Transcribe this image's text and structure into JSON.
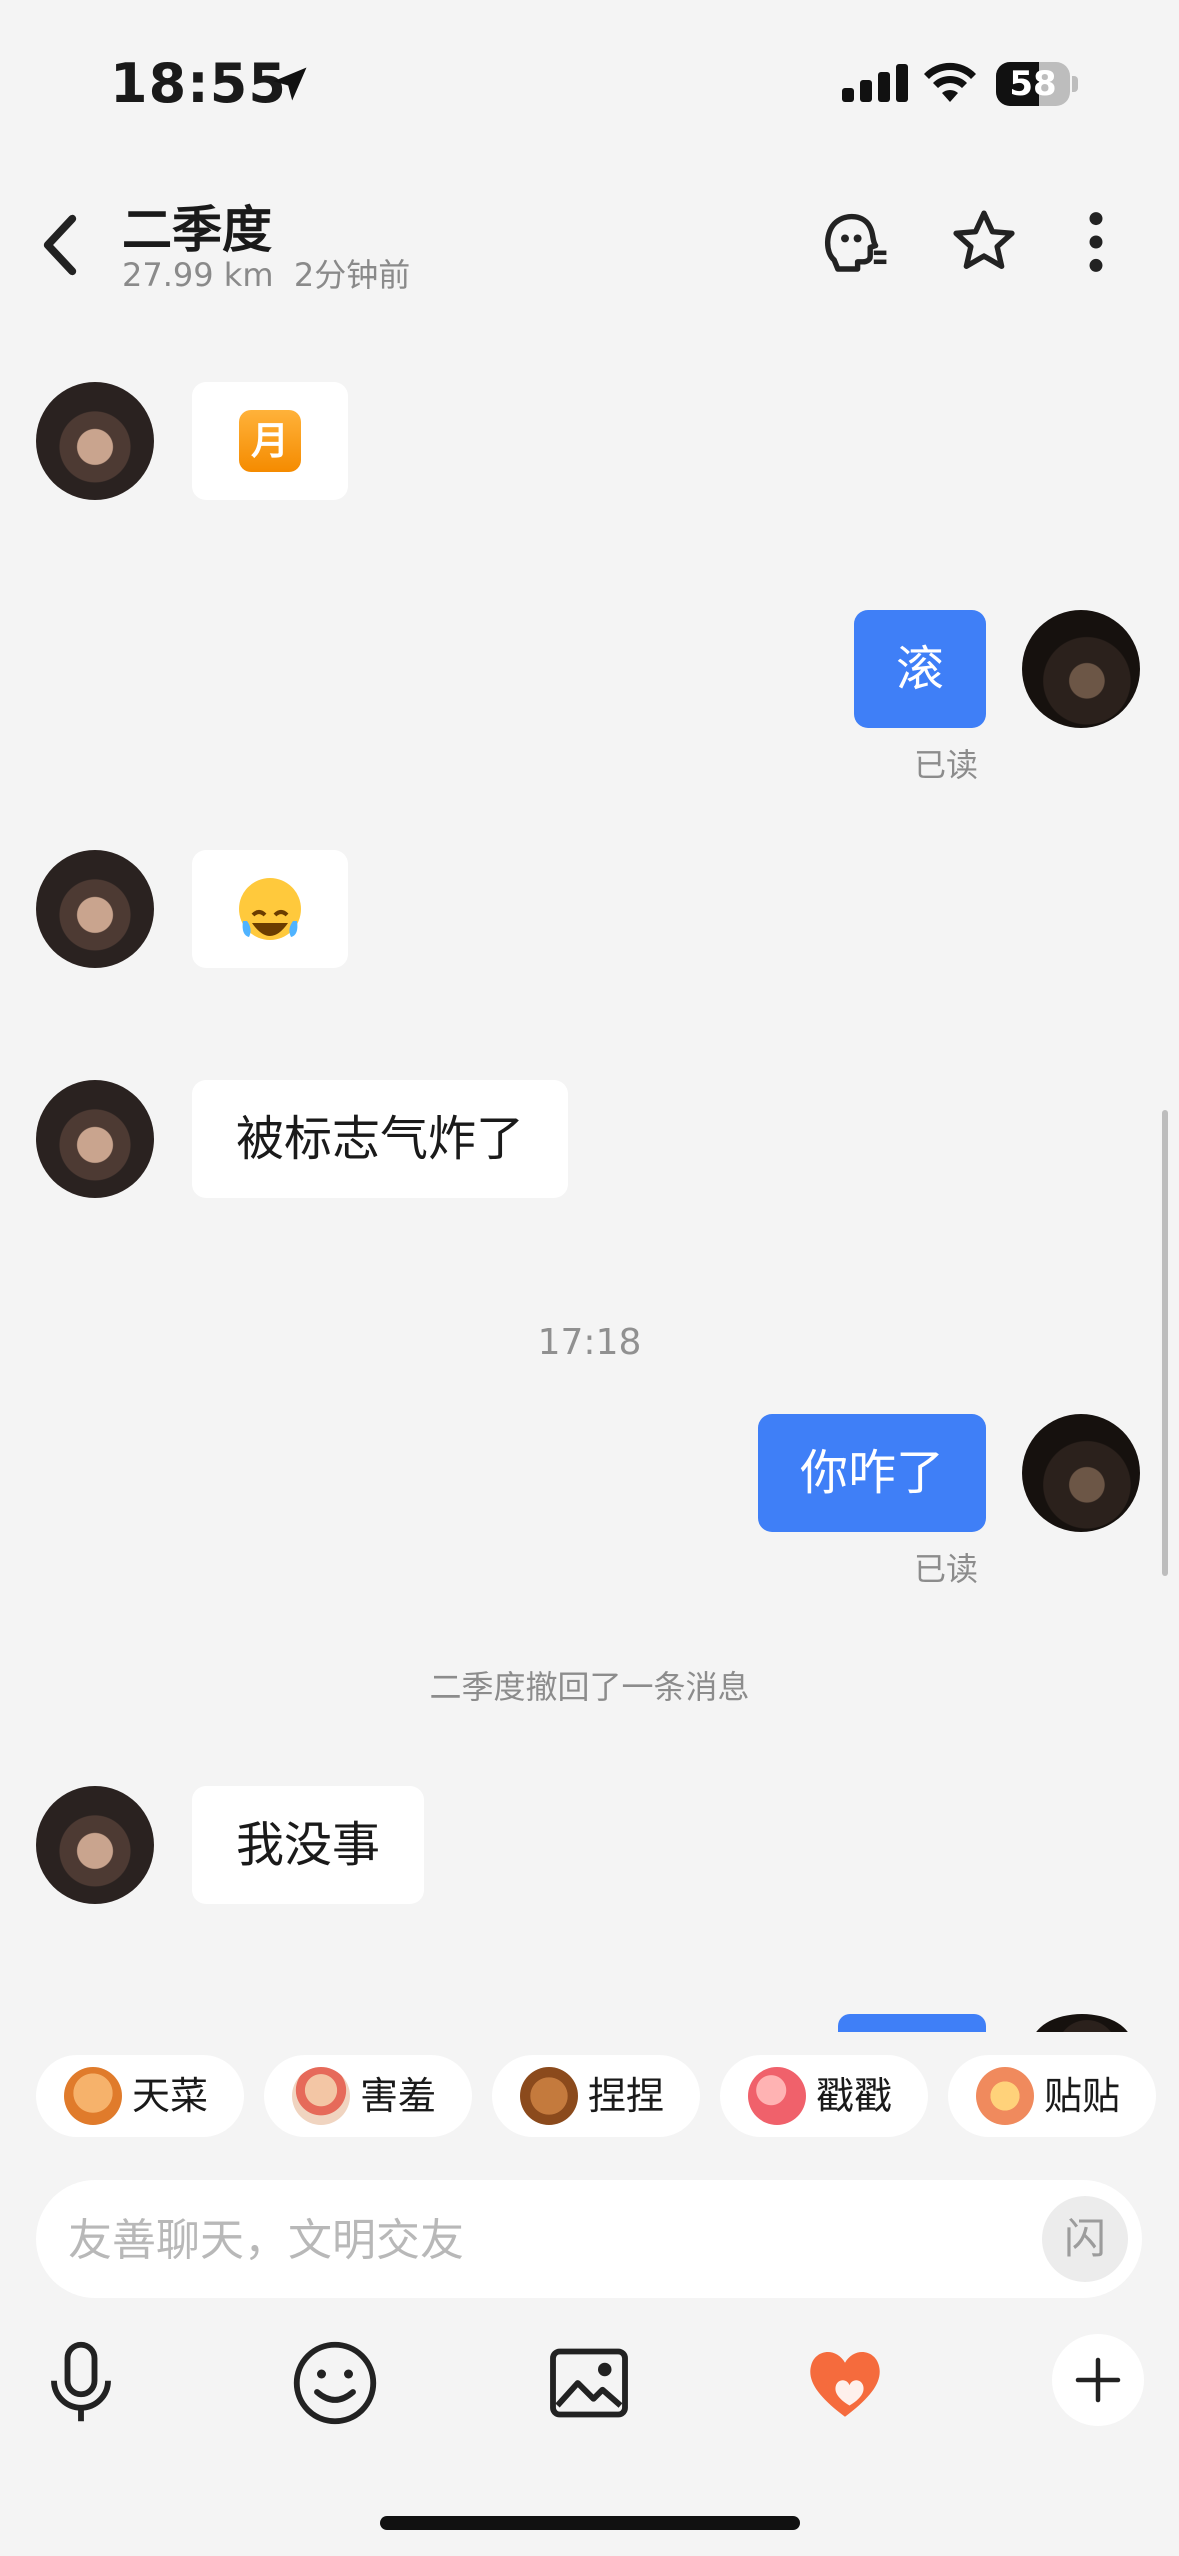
{
  "status_bar": {
    "time": "18:55",
    "battery": "58",
    "battery_level": 0.58
  },
  "header": {
    "name": "二季度",
    "distance": "27.99 km",
    "last_active": "2分钟前"
  },
  "messages": {
    "m1_emoji": "月",
    "m2_text": "滚",
    "m2_read": "已读",
    "m4_text": "被标志气炸了",
    "timestamp": "17:18",
    "m5_text": "你咋了",
    "m5_read": "已读",
    "recall_notice": "二季度撤回了一条消息",
    "m6_text": "我没事"
  },
  "quick_reactions": [
    {
      "label": "天菜",
      "icon": "dog-sticker-icon"
    },
    {
      "label": "害羞",
      "icon": "shy-sticker-icon"
    },
    {
      "label": "捏捏",
      "icon": "bear-sticker-icon"
    },
    {
      "label": "戳戳",
      "icon": "peach-sticker-icon"
    },
    {
      "label": "贴贴",
      "icon": "hug-sticker-icon"
    }
  ],
  "input": {
    "placeholder": "友善聊天，文明交友",
    "value": "",
    "flash_label": "闪"
  },
  "colors": {
    "outgoing_bubble": "#3f7ff7",
    "incoming_bubble": "#ffffff",
    "background": "#f4f4f4"
  }
}
